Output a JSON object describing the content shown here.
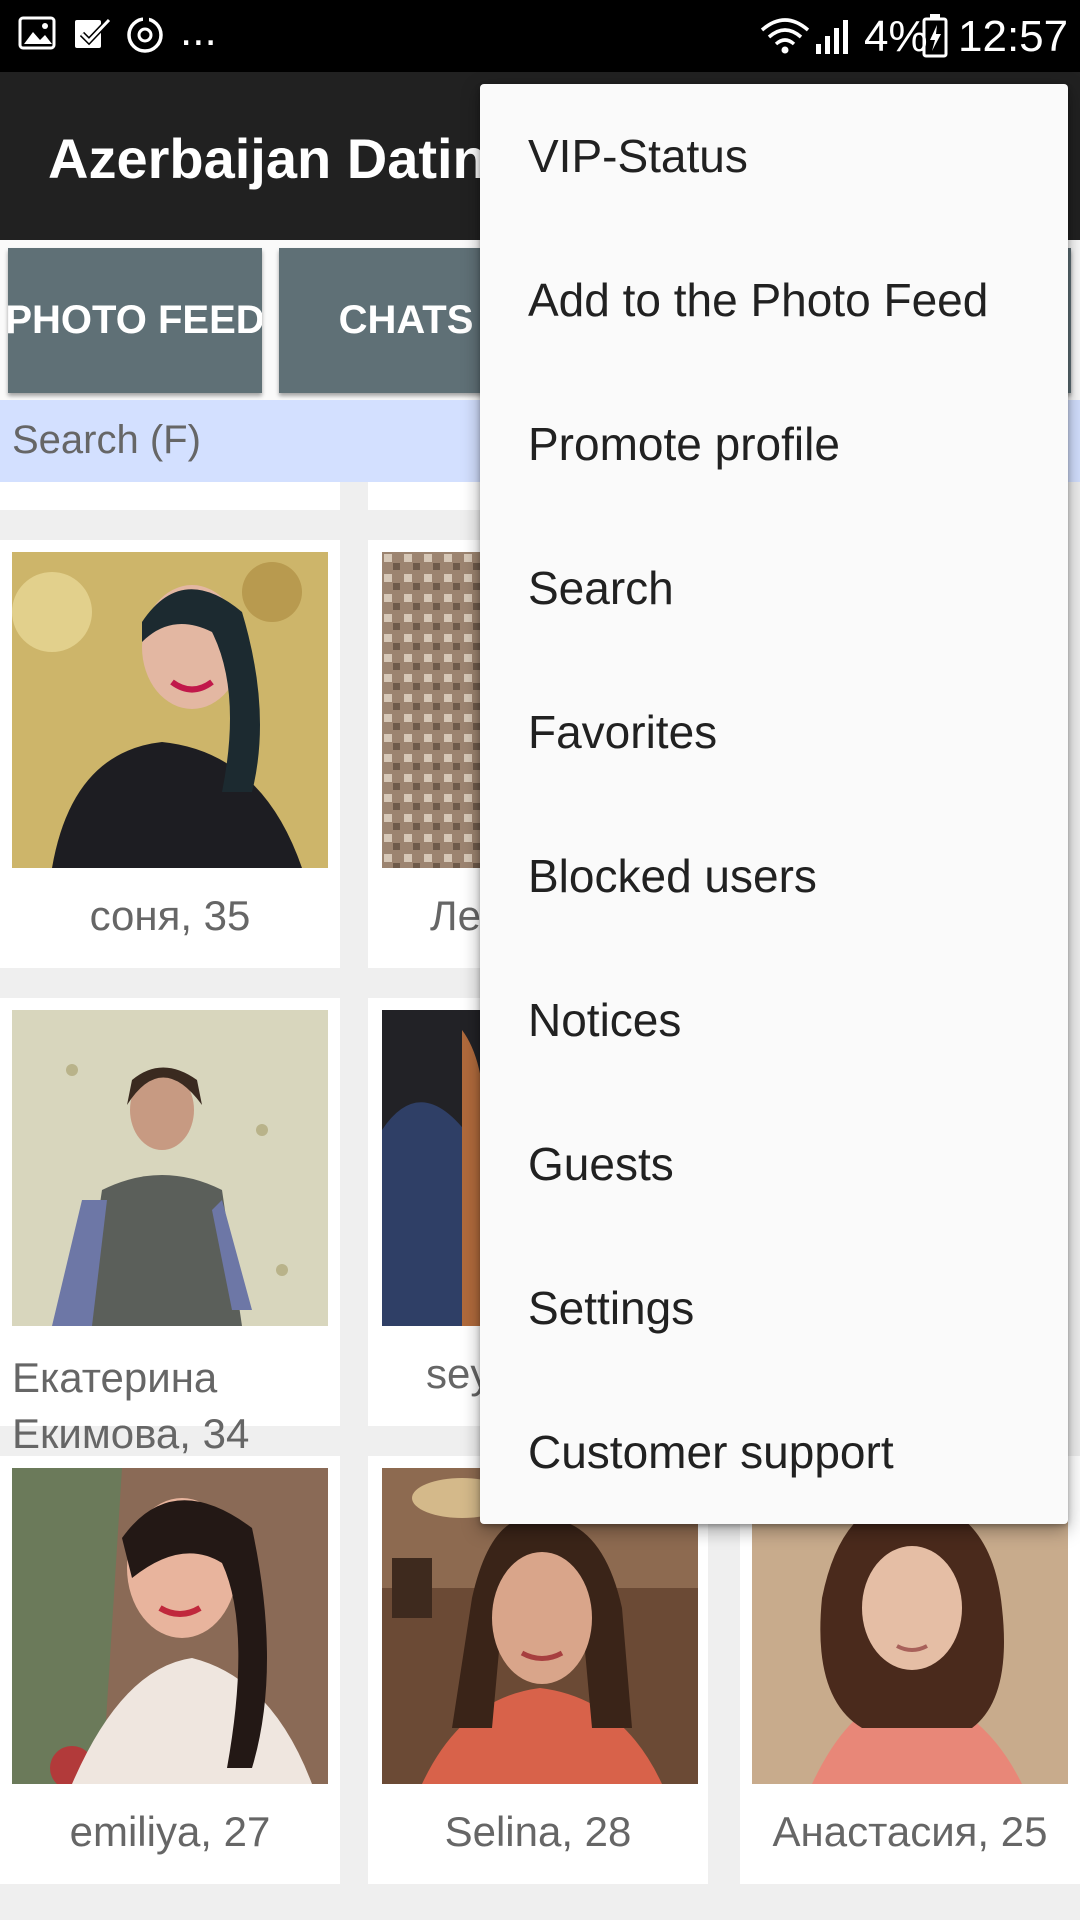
{
  "status_bar": {
    "icons": [
      "gallery-icon",
      "task-check-icon",
      "sync-icon",
      "wifi-icon",
      "signal-icon",
      "battery-charging-icon"
    ],
    "more": "...",
    "battery": "4%",
    "time": "12:57"
  },
  "app_bar": {
    "title": "Azerbaijan Dating"
  },
  "tabs": [
    "PHOTO FEED",
    "CHATS"
  ],
  "search": {
    "label": "Search (F)"
  },
  "profiles": [
    {
      "name": "соня, 35"
    },
    {
      "name": "Ле"
    },
    {
      "name": "Екатерина Екимова, 34"
    },
    {
      "name": "sey"
    },
    {
      "name": "emiliya, 27"
    },
    {
      "name": "Selina, 28"
    },
    {
      "name": "Анастасия, 25"
    }
  ],
  "menu": {
    "items": [
      "VIP-Status",
      "Add to the Photo Feed",
      "Promote profile",
      "Search",
      "Favorites",
      "Blocked users",
      "Notices",
      "Guests",
      "Settings",
      "Customer support"
    ]
  },
  "colors": {
    "app_bar": "#212121",
    "tab": "#5f7076",
    "search_bg": "#d3e0ff",
    "menu_bg": "#fafafa"
  }
}
